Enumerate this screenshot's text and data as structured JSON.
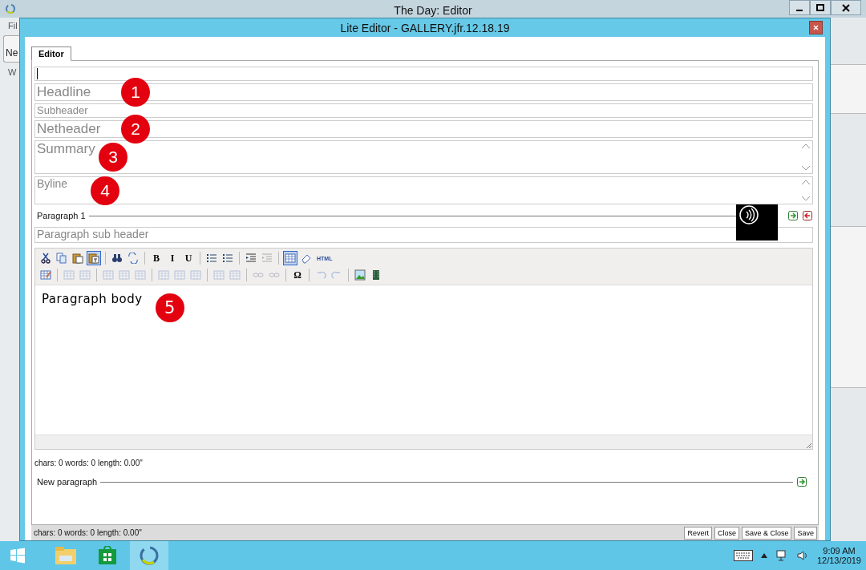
{
  "app": {
    "title": "The Day: Editor",
    "partial_texts": [
      "Fil",
      "Ne",
      "W"
    ]
  },
  "dialog": {
    "title": "Lite Editor - GALLERY.jfr.12.18.19",
    "tabs": [
      {
        "label": "Editor",
        "selected": true
      }
    ],
    "fields": [
      {
        "kind": "input",
        "focused": true
      },
      {
        "kind": "large-input",
        "placeholder": "Headline",
        "marker": "1"
      },
      {
        "kind": "input",
        "placeholder": "Subheader"
      },
      {
        "kind": "large-input",
        "placeholder": "Netheader",
        "marker": "2"
      },
      {
        "kind": "large-textarea",
        "placeholder": "Summary",
        "marker": "3"
      },
      {
        "kind": "textarea",
        "placeholder": "Byline",
        "marker": "4"
      }
    ],
    "paragraphs": [
      {
        "label": "Paragraph 1",
        "subheader_placeholder": "Paragraph sub header",
        "body": "Paragraph body",
        "body_marker": "5",
        "stats": "chars: 0 words: 0 length: 0.00\"",
        "toolbar": [
          [
            {
              "kind": "icon",
              "selected": false,
              "disabled": false
            },
            {
              "kind": "icon",
              "selected": false,
              "disabled": false
            },
            {
              "kind": "icon",
              "selected": false,
              "disabled": false
            },
            {
              "kind": "icon",
              "selected": true,
              "disabled": false
            },
            {
              "kind": "separator"
            },
            {
              "kind": "icon",
              "selected": false,
              "disabled": false
            },
            {
              "kind": "icon",
              "selected": false,
              "disabled": false
            },
            {
              "kind": "separator"
            },
            {
              "kind": "text",
              "label": "B",
              "selected": false,
              "disabled": false
            },
            {
              "kind": "text",
              "label": "I",
              "selected": false,
              "disabled": false
            },
            {
              "kind": "text",
              "label": "U",
              "selected": false,
              "disabled": false
            },
            {
              "kind": "separator"
            },
            {
              "kind": "icon",
              "selected": false,
              "disabled": false
            },
            {
              "kind": "icon",
              "selected": false,
              "disabled": false
            },
            {
              "kind": "separator"
            },
            {
              "kind": "icon",
              "selected": false,
              "disabled": false
            },
            {
              "kind": "icon",
              "selected": false,
              "disabled": true
            },
            {
              "kind": "separator"
            },
            {
              "kind": "icon",
              "selected": true,
              "disabled": false
            },
            {
              "kind": "icon",
              "selected": false,
              "disabled": false
            },
            {
              "kind": "text",
              "label": "HTML",
              "selected": false,
              "disabled": false
            }
          ],
          [
            {
              "kind": "icon",
              "selected": false,
              "disabled": false
            },
            {
              "kind": "separator"
            },
            {
              "kind": "icon",
              "selected": false,
              "disabled": true
            },
            {
              "kind": "icon",
              "selected": false,
              "disabled": true
            },
            {
              "kind": "separator"
            },
            {
              "kind": "icon",
              "selected": false,
              "disabled": true
            },
            {
              "kind": "icon",
              "selected": false,
              "disabled": true
            },
            {
              "kind": "icon",
              "selected": false,
              "disabled": true
            },
            {
              "kind": "separator"
            },
            {
              "kind": "icon",
              "selected": false,
              "disabled": true
            },
            {
              "kind": "icon",
              "selected": false,
              "disabled": true
            },
            {
              "kind": "icon",
              "selected": false,
              "disabled": true
            },
            {
              "kind": "separator"
            },
            {
              "kind": "icon",
              "selected": false,
              "disabled": true
            },
            {
              "kind": "icon",
              "selected": false,
              "disabled": true
            },
            {
              "kind": "separator"
            },
            {
              "kind": "icon",
              "selected": false,
              "disabled": true
            },
            {
              "kind": "icon",
              "selected": false,
              "disabled": true
            },
            {
              "kind": "separator"
            },
            {
              "kind": "text",
              "label": "Ω",
              "selected": false,
              "disabled": false
            },
            {
              "kind": "separator"
            },
            {
              "kind": "icon",
              "selected": false,
              "disabled": true
            },
            {
              "kind": "icon",
              "selected": false,
              "disabled": true
            },
            {
              "kind": "separator"
            },
            {
              "kind": "icon",
              "selected": false,
              "disabled": false
            },
            {
              "kind": "icon",
              "selected": false,
              "disabled": false
            }
          ]
        ]
      }
    ],
    "new_paragraph": {
      "label": "New paragraph"
    },
    "status": "chars: 0 words: 0 length: 0.00\"",
    "buttons": [
      "Revert",
      "Close",
      "Save & Close",
      "Save"
    ]
  },
  "taskbar": {
    "apps": [
      {
        "selected": false
      },
      {
        "selected": false
      },
      {
        "selected": true
      }
    ],
    "time": "9:09 AM",
    "date": "12/13/2019"
  }
}
